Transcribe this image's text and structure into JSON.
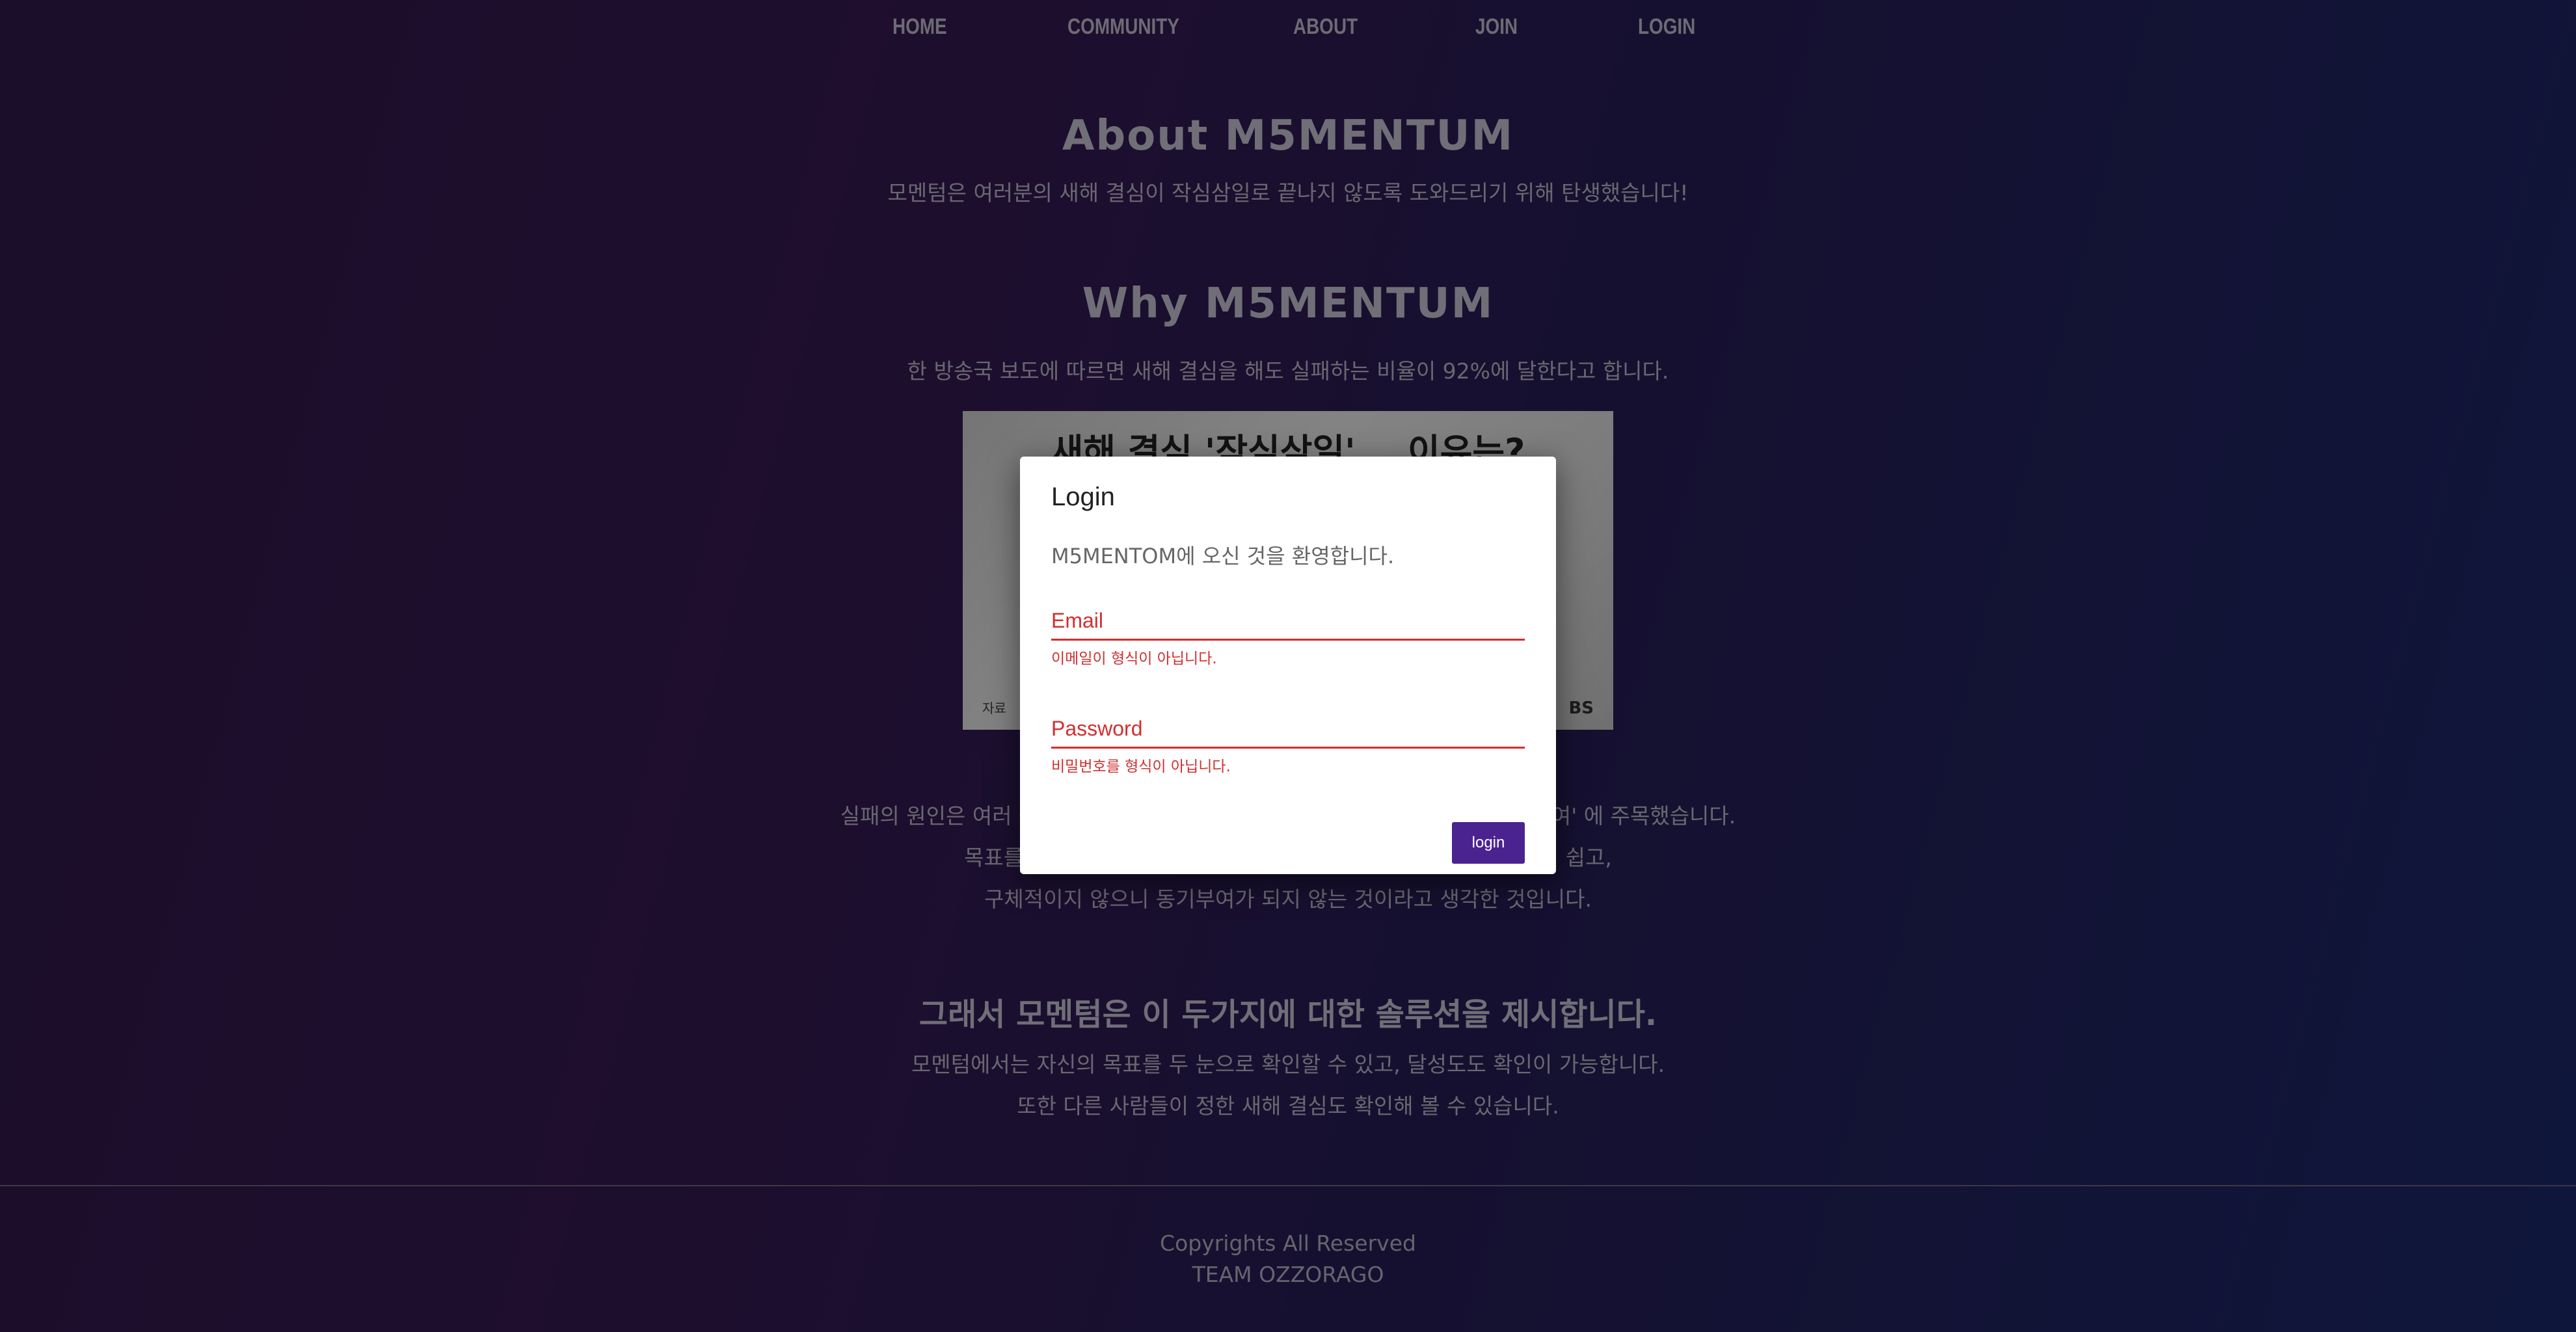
{
  "nav": {
    "home": "HOME",
    "community": "COMMUNITY",
    "about": "ABOUT",
    "join": "JOIN",
    "login": "LOGIN"
  },
  "about": {
    "title": "About M5MENTUM",
    "description": "모멘텀은 여러분의 새해 결심이 작심삼일로 끝나지 않도록 도와드리기 위해 탄생했습니다!"
  },
  "why": {
    "title": "Why M5MENTUM",
    "description": "한 방송국 보도에 따르면 새해 결심을 해도 실패하는 비율이 92%에 달한다고 합니다.",
    "image_headline": "새해 결심 '작심삼일'... 이유는?",
    "image_source": "자료",
    "image_logo": "BS"
  },
  "cause": {
    "line1": "실패의 원인은 여러 곳에 있겠지만 저희는 그중에서도 '목표의 시각화'와 '동기부여' 에 주목했습니다.",
    "line2": "목표를 세워도 그 목표가 눈에 보이지 않으니 그 목표를 잊어버리기 쉽고,",
    "line3": "구체적이지 않으니 동기부여가 되지 않는 것이라고 생각한 것입니다."
  },
  "solution": {
    "title": "그래서 모멘텀은 이 두가지에 대한 솔루션을 제시합니다.",
    "line1": "모멘텀에서는 자신의 목표를 두 눈으로 확인할 수 있고, 달성도도 확인이 가능합니다.",
    "line2": "또한 다른 사람들이 정한 새해 결심도 확인해 볼 수 있습니다."
  },
  "footer": {
    "copyright": "Copyrights All Reserved",
    "team": "TEAM OZZORAGO"
  },
  "login_modal": {
    "title": "Login",
    "welcome": "M5MENTOM에 오신 것을 환영합니다.",
    "email_placeholder": "Email",
    "email_error": "이메일이 형식이 아닙니다.",
    "password_placeholder": "Password",
    "password_error": "비밀번호를 형식이 아닙니다.",
    "login_button": "login"
  },
  "colors": {
    "error": "#d32f2f",
    "button": "#4a2391"
  }
}
